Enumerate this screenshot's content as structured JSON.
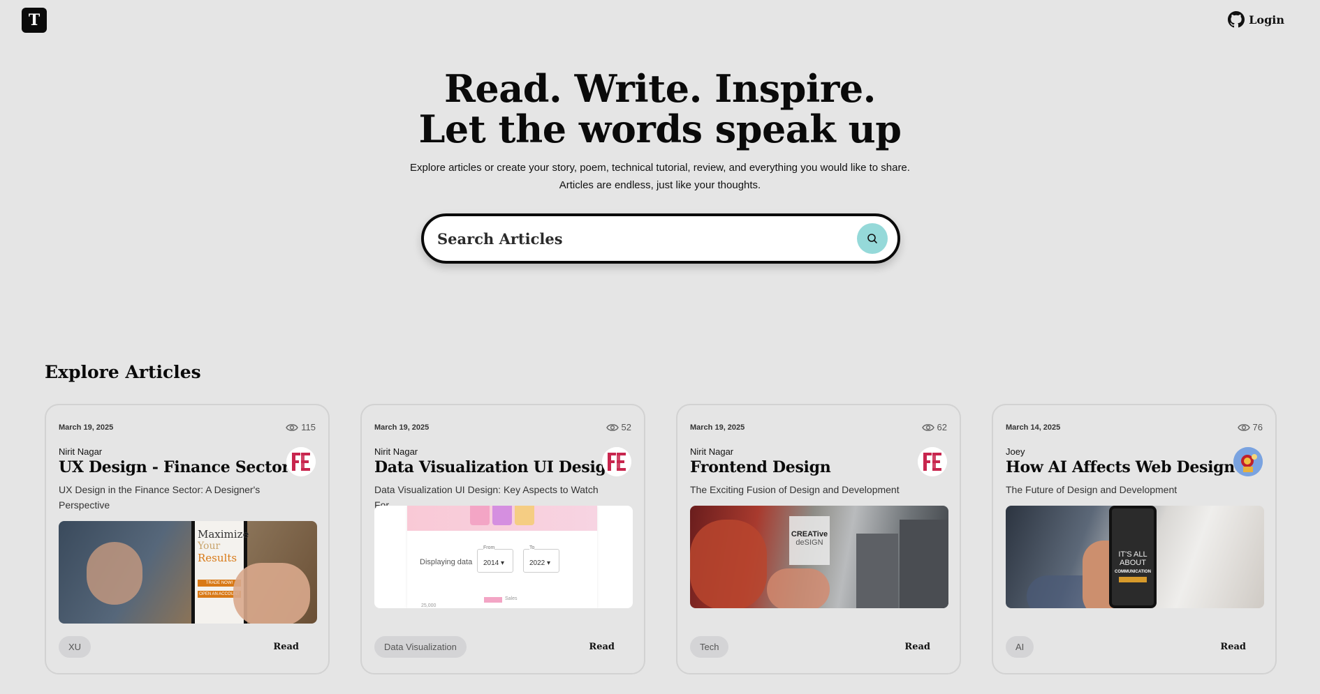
{
  "header": {
    "logo_letter": "T",
    "login_label": "Login"
  },
  "hero": {
    "title_line1": "Read. Write. Inspire.",
    "title_line2": "Let the words speak up",
    "sub_line1": "Explore articles or create your story, poem, technical tutorial, review, and everything you would like to share.",
    "sub_line2": "Articles are endless, just like your thoughts."
  },
  "search": {
    "placeholder": "Search Articles",
    "accent_color": "#95d9d9"
  },
  "explore": {
    "title": "Explore Articles",
    "cards": [
      {
        "date": "March 19, 2025",
        "views": "115",
        "author": "Nirit Nagar",
        "title": "UX Design - Finance Sector",
        "description": "UX Design in the Finance Sector: A Designer's Perspective",
        "tag": "XU",
        "read_label": "Read",
        "thumb_text": {
          "l1": "Maximize",
          "l2": "Your",
          "l3": "Results",
          "btn1": "TRADE NOW!",
          "btn2": "OPEN AN ACCOUNT"
        }
      },
      {
        "date": "March 19, 2025",
        "views": "52",
        "author": "Nirit Nagar",
        "title": "Data Visualization UI Design",
        "description": "Data Visualization UI Design: Key Aspects to Watch For",
        "tag": "Data Visualization",
        "read_label": "Read",
        "thumb_text": {
          "label": "Displaying data",
          "from_label": "From",
          "from_value": "2014",
          "to_label": "To",
          "to_value": "2022",
          "axis": "25,000",
          "legend": "Sales"
        }
      },
      {
        "date": "March 19, 2025",
        "views": "62",
        "author": "Nirit Nagar",
        "title": "Frontend Design",
        "description": "The Exciting Fusion of Design and Development",
        "tag": "Tech",
        "read_label": "Read",
        "thumb_text": {
          "l1": "CREATive",
          "l2": "deSIGN"
        }
      },
      {
        "date": "March 14, 2025",
        "views": "76",
        "author": "Joey",
        "title": "How AI Affects Web Design",
        "description": "The Future of Design and Development",
        "tag": "AI",
        "read_label": "Read",
        "thumb_text": {
          "l1": "IT'S ALL",
          "l2": "ABOUT",
          "l3": "COMMUNICATION"
        }
      }
    ]
  }
}
